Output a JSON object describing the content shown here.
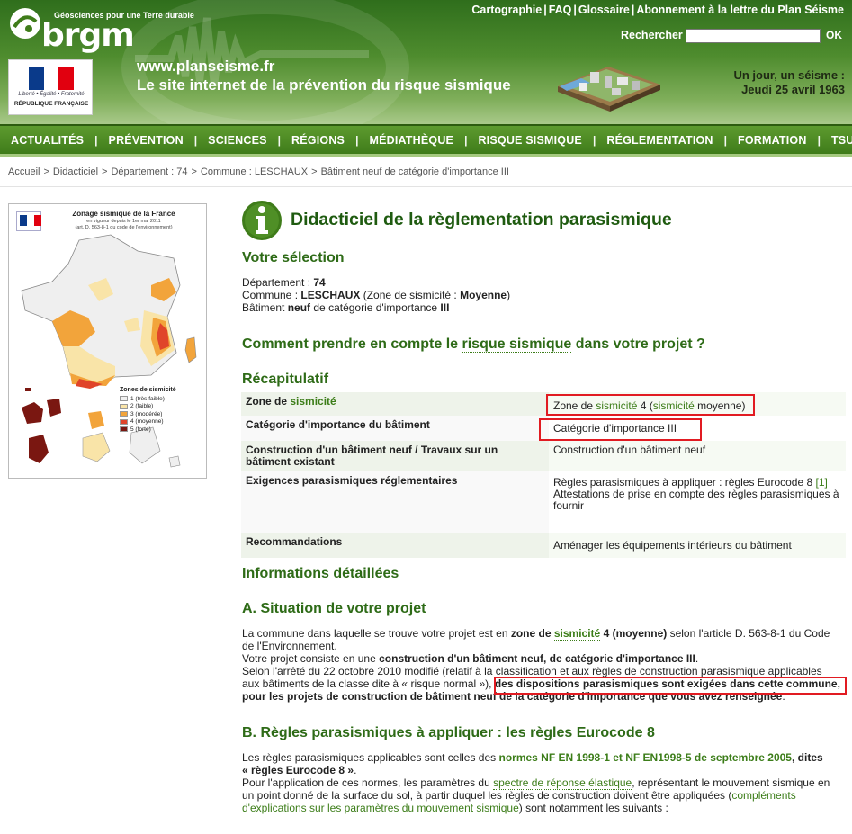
{
  "header": {
    "brgm_tagline": "Géosciences pour une Terre durable",
    "brgm_name": "brgm",
    "rf_motto": "Liberté • Égalité • Fraternité",
    "rf_name": "RÉPUBLIQUE FRANÇAISE",
    "site_url": "www.planseisme.fr",
    "site_tagline": "Le site internet de la prévention du risque sismique",
    "top_links": [
      "Cartographie",
      "FAQ",
      "Glossaire",
      "Abonnement à la lettre du Plan Séisme"
    ],
    "search_label": "Rechercher",
    "search_value": "",
    "search_ok": "OK",
    "daily_line1": "Un jour, un séisme :",
    "daily_line2": "Jeudi 25 avril 1963"
  },
  "nav": [
    "ACTUALITÉS",
    "PRÉVENTION",
    "SCIENCES",
    "RÉGIONS",
    "MÉDIATHÈQUE",
    "RISQUE SISMIQUE",
    "RÉGLEMENTATION",
    "FORMATION",
    "TSUNAMIS"
  ],
  "breadcrumb": [
    "Accueil",
    "Didacticiel",
    "Département : 74",
    "Commune : LESCHAUX",
    "Bâtiment neuf de catégorie d'importance III"
  ],
  "map": {
    "title": "Zonage sismique de la France",
    "sub1": "en vigueur depuis le 1er mai 2011",
    "sub2": "(art. D. 563-8-1 du code de l'environnement)",
    "legend_title": "Zones de sismicité",
    "legend": [
      {
        "label": "1 (très faible)",
        "color": "#f2f2f2"
      },
      {
        "label": "2 (faible)",
        "color": "#f9e4a8"
      },
      {
        "label": "3 (modérée)",
        "color": "#f2a43b"
      },
      {
        "label": "4 (moyenne)",
        "color": "#e0442a"
      },
      {
        "label": "5 (forte)",
        "color": "#7a1711"
      }
    ]
  },
  "page": {
    "title": "Didacticiel de la règlementation parasismique",
    "selection_heading": "Votre sélection",
    "dept_label": "Département : ",
    "dept_value": "74",
    "commune_label": "Commune : ",
    "commune_value": "LESCHAUX",
    "commune_zone_pre": " (Zone de sismicité : ",
    "commune_zone_value": "Moyenne",
    "commune_zone_post": ")",
    "bat_pre": "Bâtiment ",
    "bat_bold": "neuf",
    "bat_mid": " de catégorie d'importance ",
    "bat_cat": "III",
    "question_pre": "Comment prendre en compte le ",
    "question_link": "risque sismique",
    "question_post": " dans votre projet ?",
    "recap_heading": "Récapitulatif",
    "info_heading": "Informations détaillées",
    "secA_heading": "A. Situation de votre projet",
    "secB_heading": "B. Règles parasismiques à appliquer : les règles Eurocode 8"
  },
  "recap": {
    "zone_key_pre": "Zone de ",
    "zone_key_link": "sismicité",
    "zone_val_pre": "Zone de ",
    "zone_val_link1": "sismicité",
    "zone_val_mid": " 4 (",
    "zone_val_link2": "sismicité",
    "zone_val_post": " moyenne)",
    "cat_key": "Catégorie d'importance du bâtiment",
    "cat_val": "Catégorie d'importance III",
    "constr_key": "Construction d'un bâtiment neuf / Travaux sur un bâtiment existant",
    "constr_val": "Construction d'un bâtiment neuf",
    "exig_key": "Exigences parasismiques réglementaires",
    "exig_val1": "Règles parasismiques à appliquer : règles Eurocode 8 ",
    "exig_ref": "[1]",
    "exig_val2": "Attestations de prise en compte des règles parasismiques à fournir",
    "reco_key": "Recommandations",
    "reco_val": "Aménager les équipements intérieurs du bâtiment"
  },
  "secA": {
    "p1_pre": "La commune dans laquelle se trouve votre projet est en ",
    "p1_bold1": "zone de ",
    "p1_link": "sismicité",
    "p1_bold2": " 4 (moyenne)",
    "p1_post": " selon l'article D. 563-8-1 du Code",
    "p1_line2": "de l'Environnement.",
    "p2_pre": "Votre projet consiste en une ",
    "p2_bold": "construction d'un bâtiment neuf, de catégorie d'importance III",
    "p2_post": ".",
    "p3_line1": "Selon l'arrêté du 22 octobre 2010 modifié (relatif à la classification et aux règles de construction parasismique applicables",
    "p3_line2_pre": "aux bâtiments de la classe dite à « risque normal »), ",
    "p3_line2_bold": "des dispositions parasismiques sont exigées dans cette commune,",
    "p3_line3_bold": "pour les projets de construction de bâtiment neuf de la catégorie d'importance que vous avez renseignée",
    "p3_line3_post": "."
  },
  "secB": {
    "p1_pre": "Les règles parasismiques applicables sont celles des ",
    "p1_link": "normes NF EN 1998-1 et NF EN1998-5 de septembre 2005",
    "p1_bold": ", dites",
    "p1_line2": "« règles Eurocode 8 »",
    "p1_line2_post": ".",
    "p2_pre": "Pour l'application de ces normes, les paramètres du ",
    "p2_link1": "spectre de réponse élastique",
    "p2_mid": ", représentant le mouvement sismique en",
    "p2_line2_pre": "un point donné de la surface du sol, à partir duquel les règles de construction doivent être appliquées (",
    "p2_link2": "compléments",
    "p2_line3_link": "d'explications sur les paramètres du mouvement sismique",
    "p2_line3_post": ") sont notamment les suivants :"
  },
  "colors": {
    "brand_green": "#3f7c1a",
    "heading_green": "#2e6b17",
    "highlight": "#e11b22"
  }
}
